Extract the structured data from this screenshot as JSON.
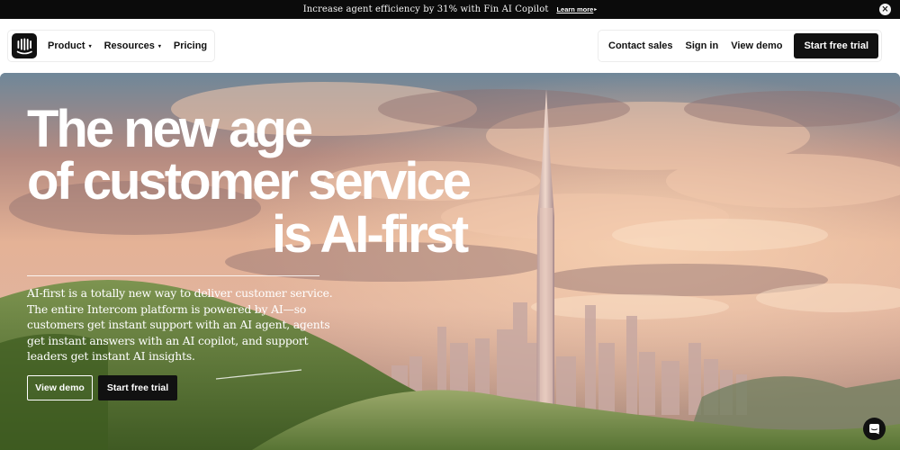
{
  "announcement": {
    "message": "Increase agent efficiency by 31% with Fin AI Copilot",
    "link": "Learn more",
    "link_arrow": "▸",
    "close_icon": "×"
  },
  "nav": {
    "logo_icon": "intercom-logo-icon",
    "left_items": [
      {
        "label": "Product",
        "has_caret": true
      },
      {
        "label": "Resources",
        "has_caret": true
      },
      {
        "label": "Pricing",
        "has_caret": false
      }
    ],
    "caret": "▾",
    "right_items": [
      "Contact sales",
      "Sign in",
      "View demo"
    ],
    "cta": "Start free trial"
  },
  "hero": {
    "headline": [
      "The new age",
      "of customer service",
      "is AI-first"
    ],
    "subtext": "AI-first is a totally new way to deliver customer service. The entire Intercom platform is powered by AI—so customers get instant support with an AI agent, agents get instant answers with an AI copilot, and support leaders get instant AI insights.",
    "buttons": {
      "demo": "View demo",
      "trial": "Start free trial"
    }
  },
  "messenger": {
    "icon": "chat-bubble-icon"
  },
  "colors": {
    "dark": "#111111",
    "white": "#ffffff"
  }
}
